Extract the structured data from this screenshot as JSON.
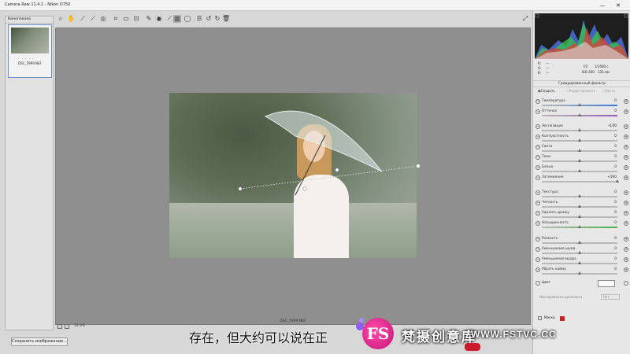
{
  "window": {
    "title": "Camera Raw 11.4.1  -  Nikon D750",
    "minimize": "—",
    "close": "✕"
  },
  "toolbar": {
    "icons": [
      "zoom-icon",
      "hand-icon",
      "white-balance-icon",
      "color-sampler-icon",
      "targeted-adjust-icon",
      "crop-icon",
      "straighten-icon",
      "transform-icon",
      "spot-removal-icon",
      "red-eye-icon",
      "adjustment-brush-icon",
      "graduated-filter-icon",
      "radial-filter-icon",
      "preferences-icon",
      "rotate-left-icon",
      "rotate-right-icon",
      "trash-icon"
    ],
    "fullscreen": "⤢"
  },
  "filmstrip": {
    "header": "Кинопленка",
    "thumb_stars": "· · · · ·",
    "thumb_name": "DSC_5999.NEF"
  },
  "canvas": {
    "filename": "DSC_5999.NEF",
    "zoom": "32.9%"
  },
  "save_button": "Сохранить изображение...",
  "readout": {
    "r_label": "R:",
    "g_label": "G:",
    "b_label": "B:",
    "r_val": "---",
    "g_val": "---",
    "b_val": "---",
    "aperture": "f/2",
    "shutter": "1/1000 с",
    "iso": "ISO 200",
    "focal": "135 мм"
  },
  "panel_title": "Градуированный фильтр",
  "modes": {
    "create": "Создать",
    "edit": "Редактировать",
    "brush": "Кисть"
  },
  "sliders": [
    {
      "label": "Температура",
      "value": "0",
      "pos": 0.5,
      "color": "#3a7bd5"
    },
    {
      "label": "Оттенок",
      "value": "0",
      "pos": 0.5,
      "color": "#9b59b6"
    },
    {
      "label": "Экспозиция",
      "value": "-4,00",
      "pos": 0.5,
      "color": ""
    },
    {
      "label": "Контрастность",
      "value": "0",
      "pos": 0.5,
      "color": ""
    },
    {
      "label": "Света",
      "value": "0",
      "pos": 0.5,
      "color": ""
    },
    {
      "label": "Тени",
      "value": "0",
      "pos": 0.5,
      "color": ""
    },
    {
      "label": "Белые",
      "value": "0",
      "pos": 0.5,
      "color": ""
    },
    {
      "label": "Затемнение",
      "value": "+100",
      "pos": 1.0,
      "color": ""
    },
    {
      "label": "Текстура",
      "value": "0",
      "pos": 0.5,
      "color": ""
    },
    {
      "label": "Четкость",
      "value": "0",
      "pos": 0.5,
      "color": ""
    },
    {
      "label": "Удалить дымку",
      "value": "0",
      "pos": 0.5,
      "color": ""
    },
    {
      "label": "Насыщенность",
      "value": "0",
      "pos": 0.5,
      "color": "#4ab04a"
    },
    {
      "label": "Резкость",
      "value": "0",
      "pos": 0.5,
      "color": ""
    },
    {
      "label": "Уменьшение шума",
      "value": "0",
      "pos": 0.5,
      "color": ""
    },
    {
      "label": "Уменьшение муара",
      "value": "0",
      "pos": 0.5,
      "color": ""
    },
    {
      "label": "Убрать кайму",
      "value": "0",
      "pos": 0.5,
      "color": ""
    }
  ],
  "color_label": "Цвет",
  "range_mask": {
    "label": "Маскирование диапазона",
    "value": "Нет"
  },
  "mask_label": "Маска",
  "subtitle": "存在，但大约可以说在正",
  "watermark": {
    "logo": "FS",
    "name": "梵摄创意库",
    "url": "WWW.FSTVC.CC"
  }
}
